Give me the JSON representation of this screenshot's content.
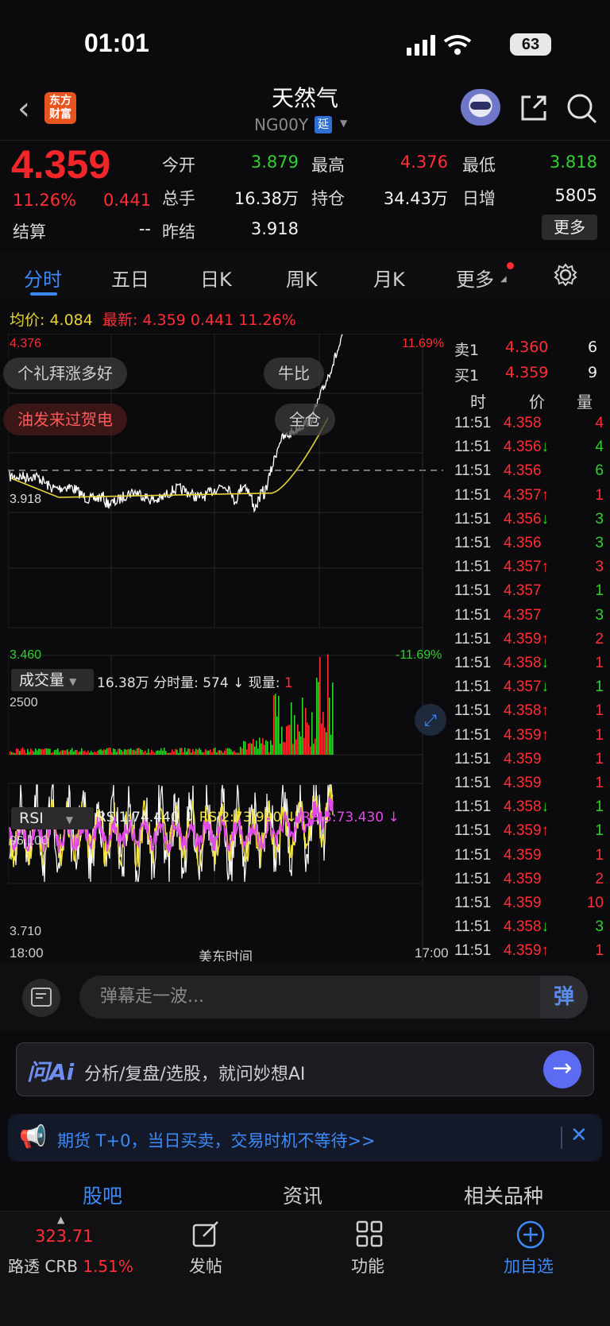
{
  "status": {
    "time": "01:01",
    "battery": "63"
  },
  "header": {
    "title": "天然气",
    "code": "NG00Y",
    "delay_badge": "延",
    "logo_text_1": "东方",
    "logo_text_2": "财富"
  },
  "quote": {
    "price": "4.359",
    "change_pct": "11.26%",
    "change": "0.441",
    "settle_label": "结算",
    "settle_value": "--",
    "open_label": "今开",
    "open_value": "3.879",
    "high_label": "最高",
    "high_value": "4.376",
    "low_label": "最低",
    "low_value": "3.818",
    "volume_label": "总手",
    "volume_value": "16.38万",
    "position_label": "持仓",
    "position_value": "34.43万",
    "daily_inc_label": "日增",
    "daily_inc_value": "5805",
    "prev_settle_label": "昨结",
    "prev_settle_value": "3.918",
    "more_button": "更多"
  },
  "tabs": [
    "分时",
    "五日",
    "日K",
    "周K",
    "月K",
    "更多"
  ],
  "avg_line": {
    "avg_label": "均价:",
    "avg_value": "4.084",
    "latest_label": "最新:",
    "latest_value": "4.359",
    "latest_change": "0.441",
    "latest_pct": "11.26%"
  },
  "chart_data": [
    {
      "type": "line",
      "title": "",
      "ylim": [
        3.46,
        4.376
      ],
      "y_labels": {
        "top": "4.376",
        "mid": "3.918",
        "bottom": "3.460",
        "top_pct": "11.69%",
        "bottom_pct": "-11.69%"
      },
      "x_labels": [
        "18:00",
        "美东时间",
        "17:00"
      ],
      "series": [],
      "reference_line": 3.918
    },
    {
      "type": "bar",
      "title": "",
      "y_label_top": "2500",
      "selector": "成交量",
      "summary": {
        "total": "16.38万",
        "per_min_label": "分时量:",
        "per_min": "574",
        "now_label": "现量:",
        "now": "1"
      }
    },
    {
      "type": "line",
      "title": "",
      "selector": "RSI",
      "y_label_top": "96.100",
      "y_label_bottom": "3.710",
      "rsi": {
        "rsi1": "RSI1:74.440",
        "rsi2": "RSI2:73.990",
        "rsi3": "RSI3:73.430"
      }
    }
  ],
  "danmu": [
    "个礼拜涨多好",
    "牛比",
    "油发来过贺电",
    "全仓"
  ],
  "orderbook": {
    "sell_label": "卖1",
    "sell_price": "4.360",
    "sell_vol": "6",
    "buy_label": "买1",
    "buy_price": "4.359",
    "buy_vol": "9",
    "col_time": "时",
    "col_price": "价",
    "col_vol": "量"
  },
  "trades": [
    {
      "time": "11:51",
      "price": "4.358",
      "dir": "",
      "vol": "4",
      "vc": "red"
    },
    {
      "time": "11:51",
      "price": "4.356",
      "dir": "↓",
      "vol": "4",
      "vc": "green"
    },
    {
      "time": "11:51",
      "price": "4.356",
      "dir": "",
      "vol": "6",
      "vc": "green"
    },
    {
      "time": "11:51",
      "price": "4.357",
      "dir": "↑",
      "vol": "1",
      "vc": "red"
    },
    {
      "time": "11:51",
      "price": "4.356",
      "dir": "↓",
      "vol": "3",
      "vc": "green"
    },
    {
      "time": "11:51",
      "price": "4.356",
      "dir": "",
      "vol": "3",
      "vc": "green"
    },
    {
      "time": "11:51",
      "price": "4.357",
      "dir": "↑",
      "vol": "3",
      "vc": "red"
    },
    {
      "time": "11:51",
      "price": "4.357",
      "dir": "",
      "vol": "1",
      "vc": "green"
    },
    {
      "time": "11:51",
      "price": "4.357",
      "dir": "",
      "vol": "3",
      "vc": "green"
    },
    {
      "time": "11:51",
      "price": "4.359",
      "dir": "↑",
      "vol": "2",
      "vc": "red"
    },
    {
      "time": "11:51",
      "price": "4.358",
      "dir": "↓",
      "vol": "1",
      "vc": "red"
    },
    {
      "time": "11:51",
      "price": "4.357",
      "dir": "↓",
      "vol": "1",
      "vc": "green"
    },
    {
      "time": "11:51",
      "price": "4.358",
      "dir": "↑",
      "vol": "1",
      "vc": "red"
    },
    {
      "time": "11:51",
      "price": "4.359",
      "dir": "↑",
      "vol": "1",
      "vc": "red"
    },
    {
      "time": "11:51",
      "price": "4.359",
      "dir": "",
      "vol": "1",
      "vc": "red"
    },
    {
      "time": "11:51",
      "price": "4.359",
      "dir": "",
      "vol": "1",
      "vc": "red"
    },
    {
      "time": "11:51",
      "price": "4.358",
      "dir": "↓",
      "vol": "1",
      "vc": "green"
    },
    {
      "time": "11:51",
      "price": "4.359",
      "dir": "↑",
      "vol": "1",
      "vc": "green"
    },
    {
      "time": "11:51",
      "price": "4.359",
      "dir": "",
      "vol": "1",
      "vc": "red"
    },
    {
      "time": "11:51",
      "price": "4.359",
      "dir": "",
      "vol": "2",
      "vc": "red"
    },
    {
      "time": "11:51",
      "price": "4.359",
      "dir": "",
      "vol": "10",
      "vc": "red"
    },
    {
      "time": "11:51",
      "price": "4.358",
      "dir": "↓",
      "vol": "3",
      "vc": "green"
    },
    {
      "time": "11:51",
      "price": "4.359",
      "dir": "↑",
      "vol": "1",
      "vc": "red"
    }
  ],
  "comment": {
    "placeholder": "弹幕走一波...",
    "send": "弹"
  },
  "ai": {
    "logo": "问Ai",
    "text": "分析/复盘/选股，就问妙想AI"
  },
  "notice": {
    "text": "期货 T+0，当日买卖，交易时机不等待>>"
  },
  "bottom_tabs": [
    "股吧",
    "资讯",
    "相关品种"
  ],
  "nav": {
    "index_value": "323.71",
    "index_name": "路透 CRB",
    "index_pct": "1.51%",
    "post": "发帖",
    "func": "功能",
    "add": "加自选"
  },
  "colors": {
    "up": "#ff2d35",
    "down": "#2fd12f",
    "accent": "#3d8af7",
    "avg": "#e8d23a"
  }
}
